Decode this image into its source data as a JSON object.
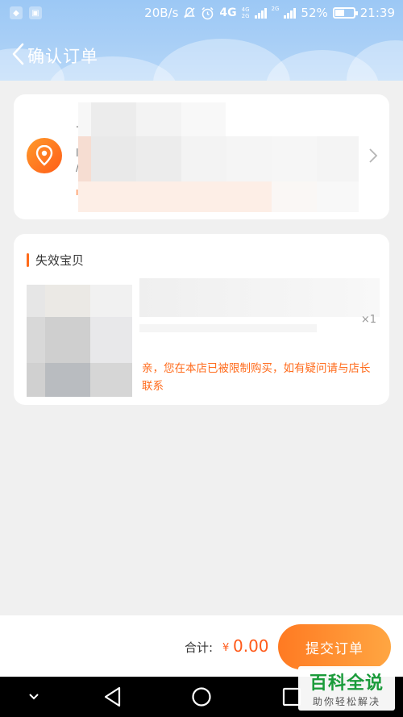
{
  "status_bar": {
    "net_speed": "20B/s",
    "network_primary": "4G",
    "network_secondary": "4G",
    "network_secondary_2": "2G",
    "network_tertiary": "2G",
    "battery_percent": "52%",
    "battery_level": 0.52,
    "time": "21:39"
  },
  "nav": {
    "title": "确认订单"
  },
  "address": {
    "line1_partial": ".",
    "line2_partial": "l",
    "line3_partial": "/",
    "line4_partial": "ı"
  },
  "invalid_section": {
    "title": "失效宝贝",
    "product_qty": "×1",
    "message": "亲，您在本店已被限制购买，如有疑问请与店长联系"
  },
  "footer": {
    "total_label": "合计:",
    "currency": "¥",
    "total_amount": "0.00",
    "submit_label": "提交订单"
  },
  "watermark": {
    "main": "百科全说",
    "sub": "助你轻松解决"
  },
  "colors": {
    "header_bg": "#a9cff6",
    "accent_orange": "#ff6a1a",
    "page_bg": "#f0f0f0"
  },
  "icons": [
    "back-chevron-icon",
    "location-pin-icon",
    "chevron-right-icon",
    "mute-icon",
    "alarm-icon",
    "signal-icon",
    "battery-icon",
    "nav-back-icon",
    "nav-home-icon",
    "nav-recents-icon",
    "nav-dropdown-icon"
  ]
}
